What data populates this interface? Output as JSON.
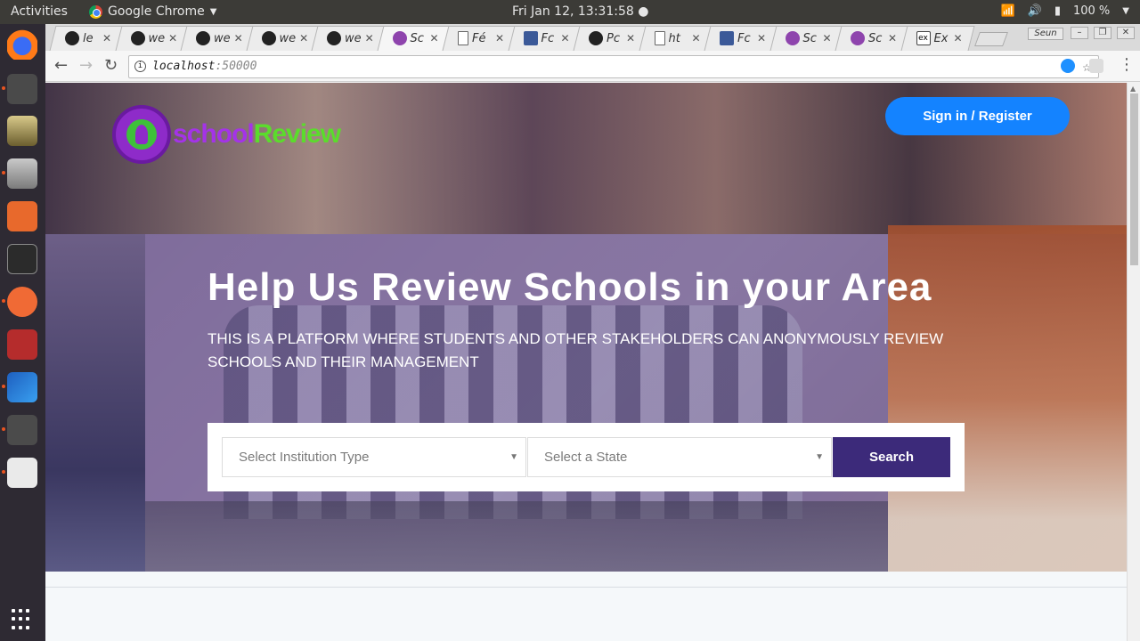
{
  "system": {
    "activities": "Activities",
    "app_name": "Google Chrome",
    "clock": "Fri Jan 12, 13:31:58",
    "battery": "100 %"
  },
  "browser": {
    "tabs": [
      {
        "title": "le",
        "icon": "github-icon"
      },
      {
        "title": "we",
        "icon": "github-icon"
      },
      {
        "title": "we",
        "icon": "github-icon"
      },
      {
        "title": "we",
        "icon": "github-icon"
      },
      {
        "title": "we",
        "icon": "github-icon"
      },
      {
        "title": "Sc",
        "icon": "schoolreview-icon",
        "active": true
      },
      {
        "title": "Fé",
        "icon": "document-icon"
      },
      {
        "title": "Fc",
        "icon": "facebook-icon"
      },
      {
        "title": "Pc",
        "icon": "github-icon"
      },
      {
        "title": "ht",
        "icon": "document-icon"
      },
      {
        "title": "Fc",
        "icon": "facebook-icon"
      },
      {
        "title": "Sc",
        "icon": "schoolreview-icon"
      },
      {
        "title": "Sc",
        "icon": "schoolreview-icon"
      },
      {
        "title": "Ex",
        "icon": "ex-icon",
        "badge": "ex"
      }
    ],
    "profile_name": "Seun",
    "url_host": "localhost",
    "url_port": ":50000"
  },
  "page": {
    "logo_part1": "school",
    "logo_part2": "Review",
    "signin_label": "Sign in / Register",
    "headline": "Help Us Review Schools in your Area",
    "subheadline": "THIS IS A PLATFORM WHERE STUDENTS AND OTHER STAKEHOLDERS CAN ANONYMOUSLY REVIEW SCHOOLS AND THEIR MANAGEMENT",
    "institution_select": "Select Institution Type",
    "state_select": "Select a State",
    "search_label": "Search"
  },
  "colors": {
    "primary_button": "#1483ff",
    "search_button": "#3c2a7a",
    "logo_purple": "#a433e8",
    "logo_green": "#5bdc2c"
  }
}
